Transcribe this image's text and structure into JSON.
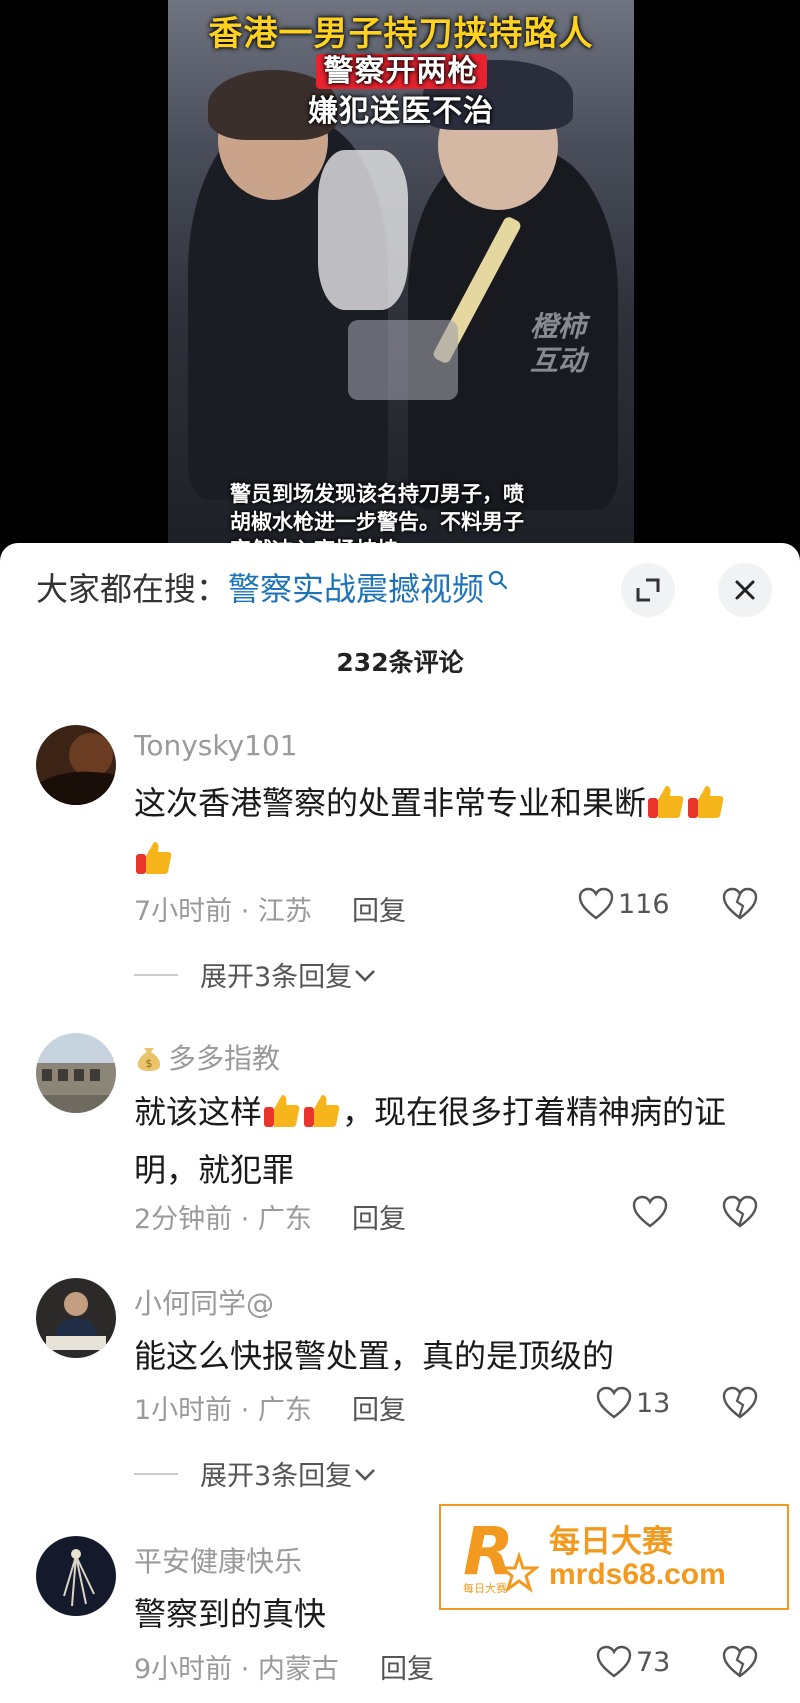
{
  "video": {
    "caption_line1": "香港一男子持刀挟持路人",
    "caption_line2": "警察开两枪",
    "caption_line3": "嫌犯送医不治",
    "subtitle_line1": "警员到场发现该名持刀男子，喷",
    "subtitle_line2": "胡椒水枪进一步警告。不料男子",
    "subtitle_line3": "突然冲入商场挟持",
    "watermark": "橙柿\n互动"
  },
  "search": {
    "prefix": "大家都在搜：",
    "term": "警察实战震撼视频"
  },
  "comments_count": "232条评论",
  "comments": [
    {
      "username": "Tonysky101",
      "text": "这次香港警察的处置非常专业和果断",
      "emoji_count": 3,
      "time_location": "7小时前 · 江苏",
      "reply_label": "回复",
      "likes": "116",
      "expand_label": "展开3条回复"
    },
    {
      "username": "多多指教",
      "text_before": "就该这样",
      "text_after": "，现在很多打着精神病的证明，就犯罪",
      "time_location": "2分钟前 · 广东",
      "reply_label": "回复",
      "likes": ""
    },
    {
      "username": "小何同学@",
      "text": "能这么快报警处置，真的是顶级的",
      "time_location": "1小时前 · 广东",
      "reply_label": "回复",
      "likes": "13",
      "expand_label": "展开3条回复"
    },
    {
      "username": "平安健康快乐",
      "text": "警察到的真快",
      "time_location": "9小时前 · 内蒙古",
      "reply_label": "回复",
      "likes": "73"
    }
  ],
  "ad": {
    "name": "每日大赛",
    "url": "mrds68.com",
    "logo_letter": "R",
    "logo_text": "每日大赛"
  },
  "colors": {
    "accent_blue": "#1d73b8",
    "ad_orange": "#f29a1f",
    "caption_yellow": "#ffd21f",
    "caption_red": "#e8232f"
  }
}
